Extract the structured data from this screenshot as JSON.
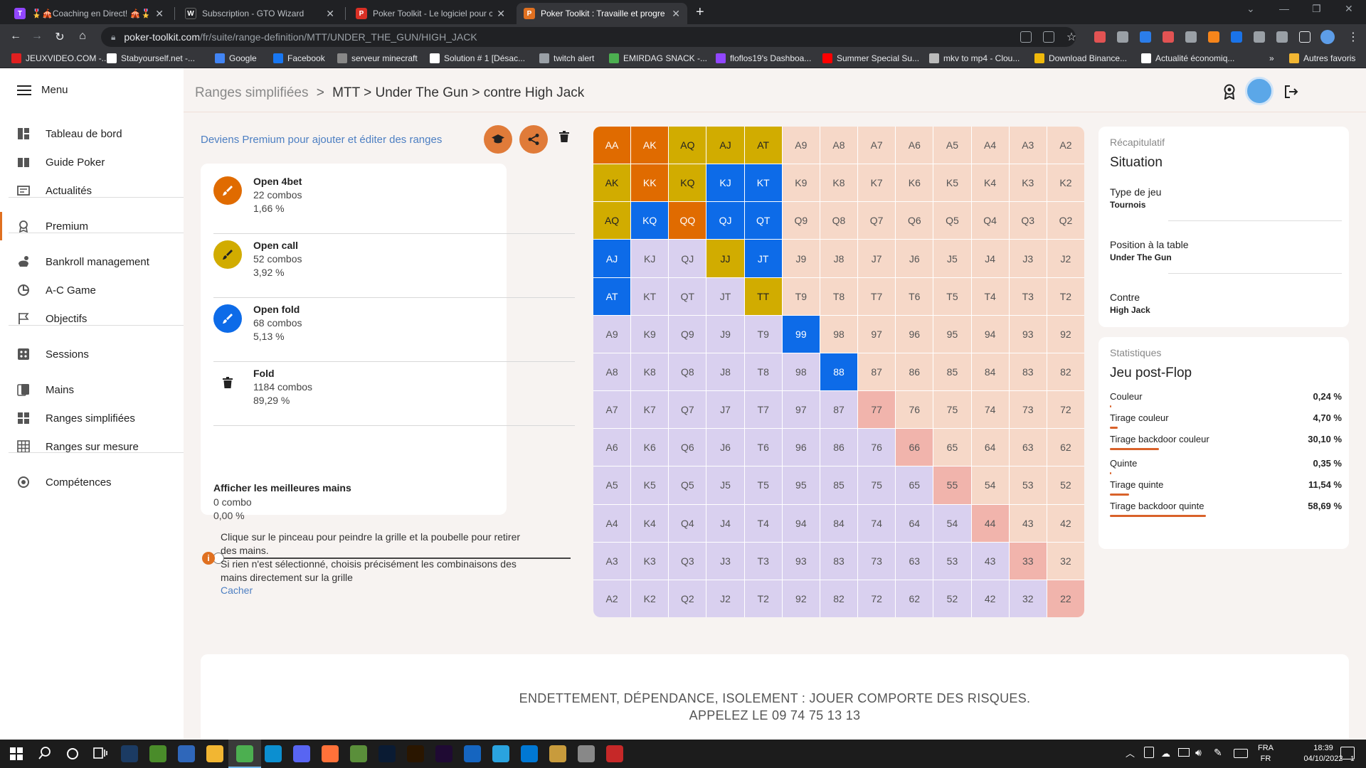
{
  "browser": {
    "tabs": [
      {
        "title": "🎖️🎪Coaching en Direct! 🎪🎖️",
        "favicon": "#9146ff",
        "glyph": "T"
      },
      {
        "title": "Subscription - GTO Wizard",
        "favicon": "#202124",
        "glyph": "W"
      },
      {
        "title": "Poker Toolkit - Le logiciel pour c",
        "favicon": "#d93025",
        "glyph": "P"
      },
      {
        "title": "Poker Toolkit : Travaille et progre",
        "favicon": "#e07020",
        "glyph": "P"
      }
    ],
    "url_host": "poker-toolkit.com",
    "url_path": "/fr/suite/range-definition/MTT/UNDER_THE_GUN/HIGH_JACK",
    "bookmarks": [
      {
        "label": "JEUXVIDEO.COM -...",
        "color": "#e02020"
      },
      {
        "label": "Stabyourself.net -...",
        "color": "#ffffff"
      },
      {
        "label": "Google",
        "color": "#4285f4"
      },
      {
        "label": "Facebook",
        "color": "#1877f2"
      },
      {
        "label": "serveur minecraft",
        "color": "#888888"
      },
      {
        "label": "Solution # 1 [Désac...",
        "color": "#ffffff"
      },
      {
        "label": "twitch alert",
        "color": "#9aa0a6"
      },
      {
        "label": "EMIRDAG SNACK -...",
        "color": "#4caf50"
      },
      {
        "label": "floflos19's Dashboa...",
        "color": "#9146ff"
      },
      {
        "label": "Summer Special Su...",
        "color": "#ff0000"
      },
      {
        "label": "mkv to mp4 - Clou...",
        "color": "#bbbbbb"
      },
      {
        "label": "Download Binance...",
        "color": "#f0b90b"
      },
      {
        "label": "Actualité économiq...",
        "color": "#ffffff"
      }
    ],
    "other_bookmarks": "Autres favoris"
  },
  "sidebar": {
    "menu_label": "Menu",
    "items": [
      {
        "label": "Tableau de bord",
        "icon": "dashboard-icon"
      },
      {
        "label": "Guide Poker",
        "icon": "book-icon"
      },
      {
        "label": "Actualités",
        "icon": "news-icon"
      },
      {
        "label": "Premium",
        "icon": "premium-badge-icon"
      },
      {
        "label": "Bankroll management",
        "icon": "bankroll-icon"
      },
      {
        "label": "A-C Game",
        "icon": "ac-game-icon"
      },
      {
        "label": "Objectifs",
        "icon": "flag-icon"
      },
      {
        "label": "Sessions",
        "icon": "sessions-icon"
      },
      {
        "label": "Mains",
        "icon": "hands-icon"
      },
      {
        "label": "Ranges simplifiées",
        "icon": "ranges-icon"
      },
      {
        "label": "Ranges sur mesure",
        "icon": "grid-icon"
      },
      {
        "label": "Compétences",
        "icon": "skills-icon"
      }
    ]
  },
  "header": {
    "crumb_root": "Ranges simplifiées",
    "crumb_sep": ">",
    "crumb_path": "MTT > Under The Gun > contre High Jack"
  },
  "premium_link": "Deviens Premium pour ajouter et éditer des ranges",
  "actions": [
    {
      "title": "Open 4bet",
      "combos": "22 combos",
      "pct": "1,66 %",
      "color": "#e06b00"
    },
    {
      "title": "Open call",
      "combos": "52 combos",
      "pct": "3,92 %",
      "color": "#d1ac00"
    },
    {
      "title": "Open fold",
      "combos": "68 combos",
      "pct": "5,13 %",
      "color": "#0d6be8"
    },
    {
      "title": "Fold",
      "combos": "1184 combos",
      "pct": "89,29 %",
      "color": "#ffffff"
    }
  ],
  "best_hands": {
    "title": "Afficher les meilleures mains",
    "combos": "0 combo",
    "pct": "0,00 %",
    "slider_value": 0
  },
  "info": {
    "line1": "Clique sur le pinceau pour peindre la grille et la poubelle pour retirer des mains.",
    "line2": "Si rien n'est sélectionné, choisis précisément les combinaisons des mains directement sur la grille",
    "hide": "Cacher"
  },
  "grid": {
    "ranks": [
      "A",
      "K",
      "Q",
      "J",
      "T",
      "9",
      "8",
      "7",
      "6",
      "5",
      "4",
      "3",
      "2"
    ],
    "actions": {
      "AA": "4bet",
      "AK": "4bet",
      "AKo": "call",
      "KK": "4bet",
      "QQ": "4bet",
      "AQ": "call",
      "AJ": "call",
      "AT": "call",
      "AQo": "call",
      "KQ": "call",
      "JJ": "call",
      "TT": "call",
      "KJ": "fold",
      "KT": "fold",
      "KQo": "fold",
      "QJ": "fold",
      "QT": "fold",
      "AJo": "fold",
      "JT": "fold",
      "ATo": "fold",
      "99": "fold",
      "88": "fold"
    },
    "highlight": [
      "77",
      "66",
      "55",
      "44",
      "33",
      "22"
    ]
  },
  "recap": {
    "label": "Récapitulatif",
    "title": "Situation",
    "rows": [
      {
        "k": "Type de jeu",
        "v": "Tournois"
      },
      {
        "k": "Position à la table",
        "v": "Under The Gun"
      },
      {
        "k": "Contre",
        "v": "High Jack"
      }
    ]
  },
  "stats": {
    "label": "Statistiques",
    "title": "Jeu post-Flop",
    "rows": [
      {
        "name": "Couleur",
        "value": "0,24 %",
        "pct": 0.24
      },
      {
        "name": "Tirage couleur",
        "value": "4,70 %",
        "pct": 4.7
      },
      {
        "name": "Tirage backdoor couleur",
        "value": "30,10 %",
        "pct": 30.1
      },
      {
        "name": "Quinte",
        "value": "0,35 %",
        "pct": 0.35
      },
      {
        "name": "Tirage quinte",
        "value": "11,54 %",
        "pct": 11.54
      },
      {
        "name": "Tirage backdoor quinte",
        "value": "58,69 %",
        "pct": 58.69
      }
    ]
  },
  "footer": {
    "line1": "ENDETTEMENT, DÉPENDANCE, ISOLEMENT : JOUER COMPORTE DES RISQUES.",
    "line2": "APPELEZ LE 09 74 75 13 13"
  },
  "taskbar": {
    "lang": "FRA",
    "lang2": "FR",
    "time": "18:39",
    "date": "04/10/2022",
    "notif": "1"
  }
}
